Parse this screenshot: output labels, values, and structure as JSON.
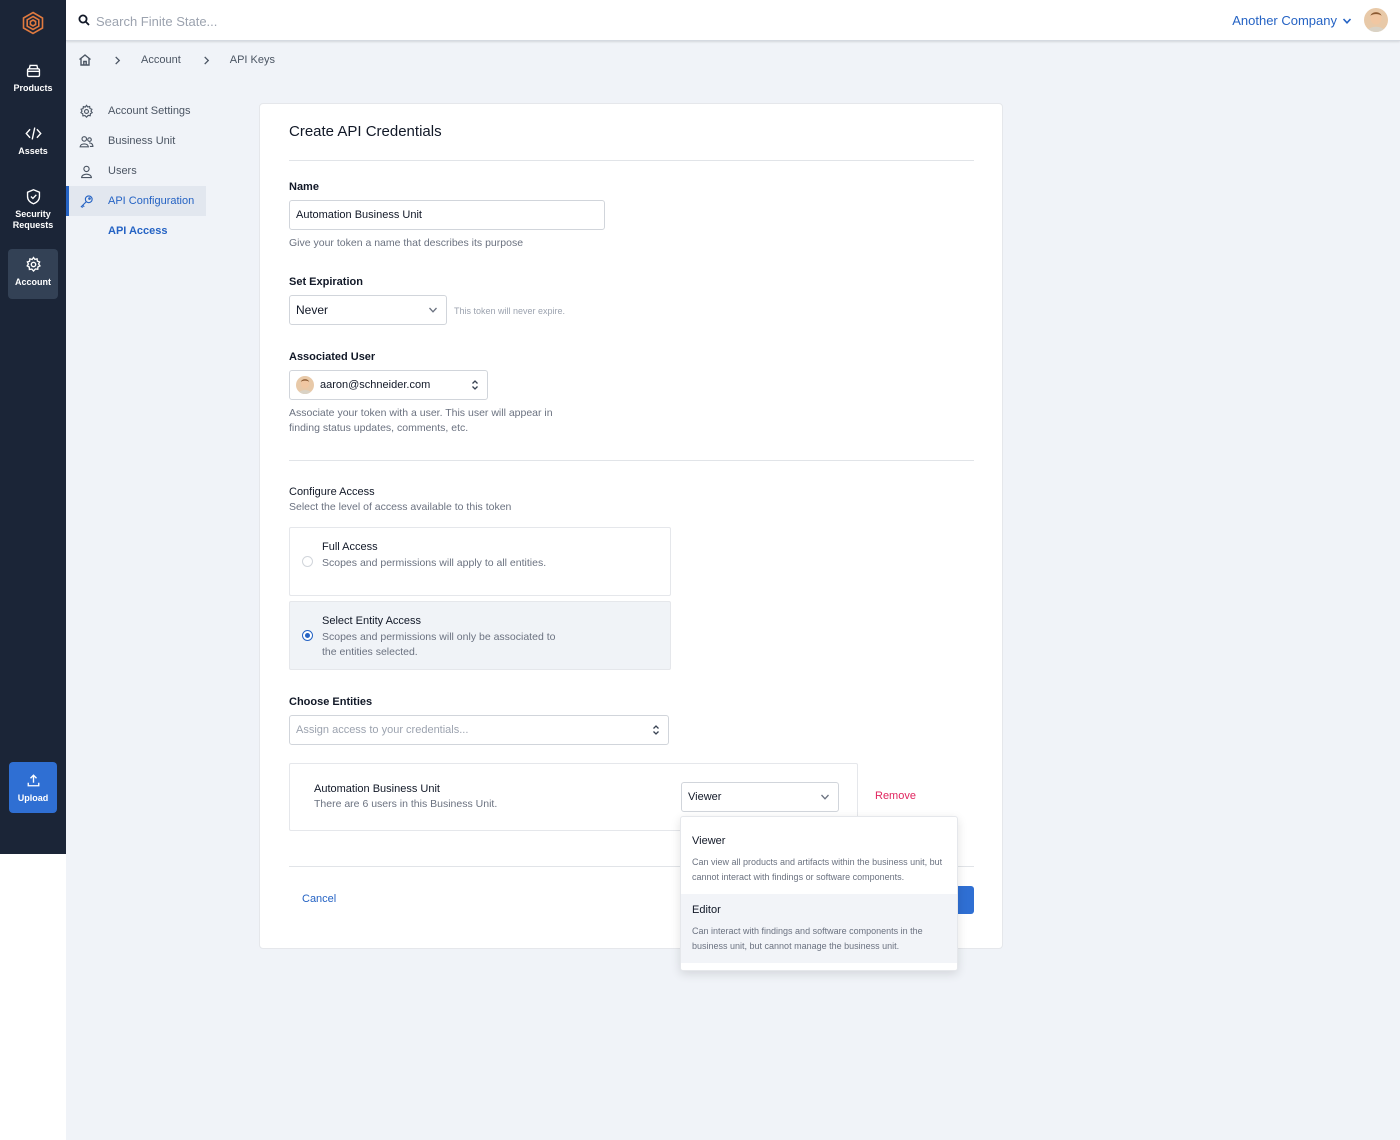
{
  "nav": {
    "items": [
      {
        "label": "Products",
        "icon": "box-icon"
      },
      {
        "label": "Assets",
        "icon": "code-icon"
      },
      {
        "label": "Security Requests",
        "icon": "shield-icon"
      },
      {
        "label": "Account",
        "icon": "gear-icon",
        "active": true
      }
    ],
    "upload_label": "Upload"
  },
  "topbar": {
    "search_placeholder": "Search Finite State...",
    "company": "Another Company"
  },
  "breadcrumb": [
    "Account",
    "API Keys"
  ],
  "subnav": {
    "items": [
      {
        "label": "Account Settings",
        "icon": "gear-icon"
      },
      {
        "label": "Business Unit",
        "icon": "users-icon"
      },
      {
        "label": "Users",
        "icon": "user-icon"
      },
      {
        "label": "API Configuration",
        "icon": "key-icon",
        "active": true
      }
    ],
    "sub_item": "API Access"
  },
  "form": {
    "title": "Create API Credentials",
    "name_label": "Name",
    "name_value": "Automation Business Unit",
    "name_help": "Give your token a name that describes its purpose",
    "expiration_label": "Set Expiration",
    "expiration_value": "Never",
    "expiration_note": "This token will never expire.",
    "user_label": "Associated User",
    "user_value": "aaron@schneider.com",
    "user_help_line1": "Associate your token with a user. This user will appear in",
    "user_help_line2": "finding status updates, comments, etc.",
    "access_title": "Configure Access",
    "access_subtitle": "Select the level of access available to this token",
    "options": [
      {
        "title": "Full Access",
        "desc": "Scopes and permissions will apply to all entities.",
        "selected": false
      },
      {
        "title": "Select Entity Access",
        "desc": "Scopes and permissions will only be associated to the entities selected.",
        "selected": true
      }
    ],
    "entities_label": "Choose Entities",
    "entities_placeholder": "Assign access to your credentials...",
    "entity": {
      "name": "Automation Business Unit",
      "desc": "There are 6 users in this Business Unit.",
      "role": "Viewer",
      "remove_label": "Remove"
    },
    "cancel_label": "Cancel"
  },
  "role_menu": [
    {
      "title": "Viewer",
      "desc": "Can view all products and artifacts within the business unit, but cannot interact with findings or software components."
    },
    {
      "title": "Editor",
      "desc": "Can interact with findings and software components in the business unit, but cannot manage the business unit."
    }
  ],
  "colors": {
    "rail": "#1b2537",
    "accent": "#2563c4",
    "danger": "#e0245e",
    "background": "#f0f3f8"
  }
}
